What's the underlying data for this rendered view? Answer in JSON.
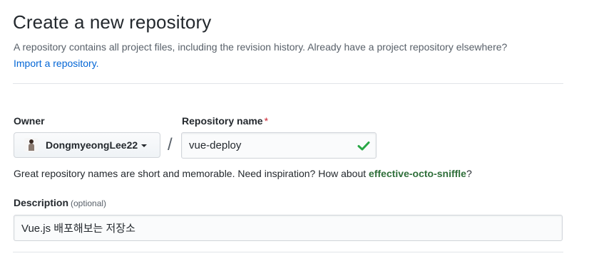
{
  "header": {
    "title": "Create a new repository",
    "subtitle": "A repository contains all project files, including the revision history. Already have a project repository elsewhere?",
    "import_link": "Import a repository."
  },
  "owner": {
    "label": "Owner",
    "name": "DongmyeongLee22",
    "avatar_icon": "user-avatar"
  },
  "repository": {
    "label": "Repository name",
    "required_mark": "*",
    "separator": "/",
    "value": "vue-deploy",
    "valid_icon": "check-icon",
    "valid_color": "#28a745"
  },
  "hint": {
    "text": "Great repository names are short and memorable. Need inspiration? How about",
    "suggestion": "effective-octo-sniffle",
    "end": "?"
  },
  "description": {
    "label": "Description",
    "optional_label": "(optional)",
    "value": "Vue.js 배포해보는 저장소"
  },
  "colors": {
    "link": "#0366d6",
    "required": "#cb2431",
    "suggestion": "#2f6f3a"
  }
}
